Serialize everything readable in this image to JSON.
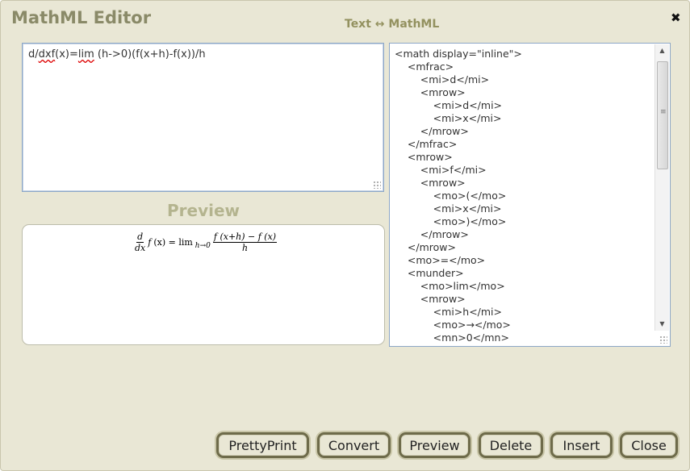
{
  "dialog": {
    "title": "MathML Editor",
    "subtitle": "Text ↔ MathML",
    "close_glyph": "✖"
  },
  "text_input": {
    "value_parts": [
      "d/",
      "dxf",
      "(x)=",
      "lim",
      " (h->0)(f(x+h)-f(x))/h"
    ]
  },
  "preview": {
    "label": "Preview",
    "math": {
      "frac1_num": "d",
      "frac1_den": "dx",
      "f": "f",
      "fx": "(x) = lim",
      "sub": "h→0",
      "frac2_num": "f (x+h) − f (x)",
      "frac2_den": "h"
    }
  },
  "mathml": {
    "lines": [
      "<math display=\"inline\">",
      "    <mfrac>",
      "        <mi>d</mi>",
      "        <mrow>",
      "            <mi>d</mi>",
      "            <mi>x</mi>",
      "        </mrow>",
      "    </mfrac>",
      "    <mrow>",
      "        <mi>f</mi>",
      "        <mrow>",
      "            <mo>(</mo>",
      "            <mi>x</mi>",
      "            <mo>)</mo>",
      "        </mrow>",
      "    </mrow>",
      "    <mo>=</mo>",
      "    <munder>",
      "        <mo>lim</mo>",
      "        <mrow>",
      "            <mi>h</mi>",
      "            <mo>→</mo>",
      "            <mn>0</mn>"
    ]
  },
  "buttons": {
    "prettyprint": "PrettyPrint",
    "convert": "Convert",
    "preview": "Preview",
    "delete": "Delete",
    "insert": "Insert",
    "close": "Close"
  },
  "icons": {
    "close": "close-icon",
    "resize": "resize-grip-icon",
    "scroll_up": "arrow-up-icon",
    "scroll_down": "arrow-down-icon"
  },
  "colors": {
    "dialog_bg": "#e9e7d5",
    "title": "#8a8a68",
    "button_border": "#6e6b4a"
  }
}
